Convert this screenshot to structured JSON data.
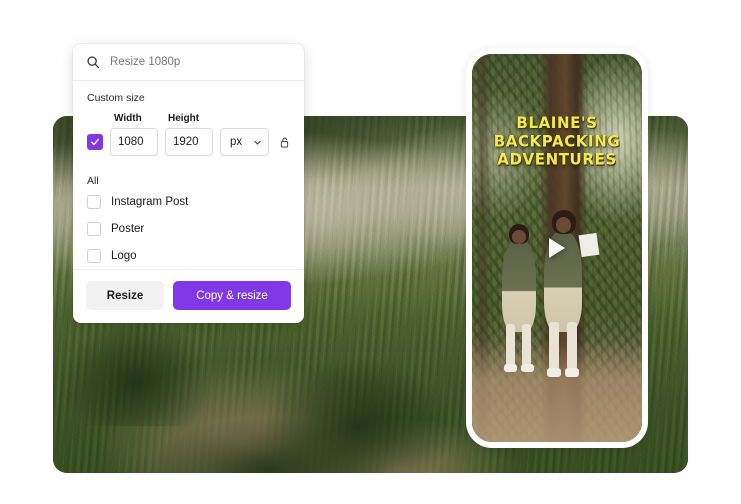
{
  "search": {
    "icon": "search-icon",
    "placeholder": "Resize 1080p",
    "value": ""
  },
  "custom_size": {
    "section_label": "Custom size",
    "width_label": "Width",
    "height_label": "Height",
    "width_value": "1080",
    "height_value": "1920",
    "unit_value": "px",
    "unit_caret_icon": "chevron-down-icon",
    "lock_icon": "unlock-icon",
    "link_checkbox_checked": true
  },
  "all_section": {
    "label": "All",
    "options": [
      {
        "label": "Instagram Post",
        "checked": false
      },
      {
        "label": "Poster",
        "checked": false
      },
      {
        "label": "Logo",
        "checked": false
      }
    ]
  },
  "footer": {
    "resize_label": "Resize",
    "copy_resize_label": "Copy & resize"
  },
  "phone_preview": {
    "title_line1": "BLAINE'S",
    "title_line2": "BACKPACKING",
    "title_line3": "ADVENTURES",
    "play_icon": "play-icon"
  },
  "colors": {
    "accent_purple": "#8139e8",
    "title_yellow": "#f5e94e",
    "panel_background": "#ffffff",
    "secondary_button": "#f2f2f2",
    "placeholder_text": "#9b9b9b",
    "border": "#dcdcdc"
  }
}
